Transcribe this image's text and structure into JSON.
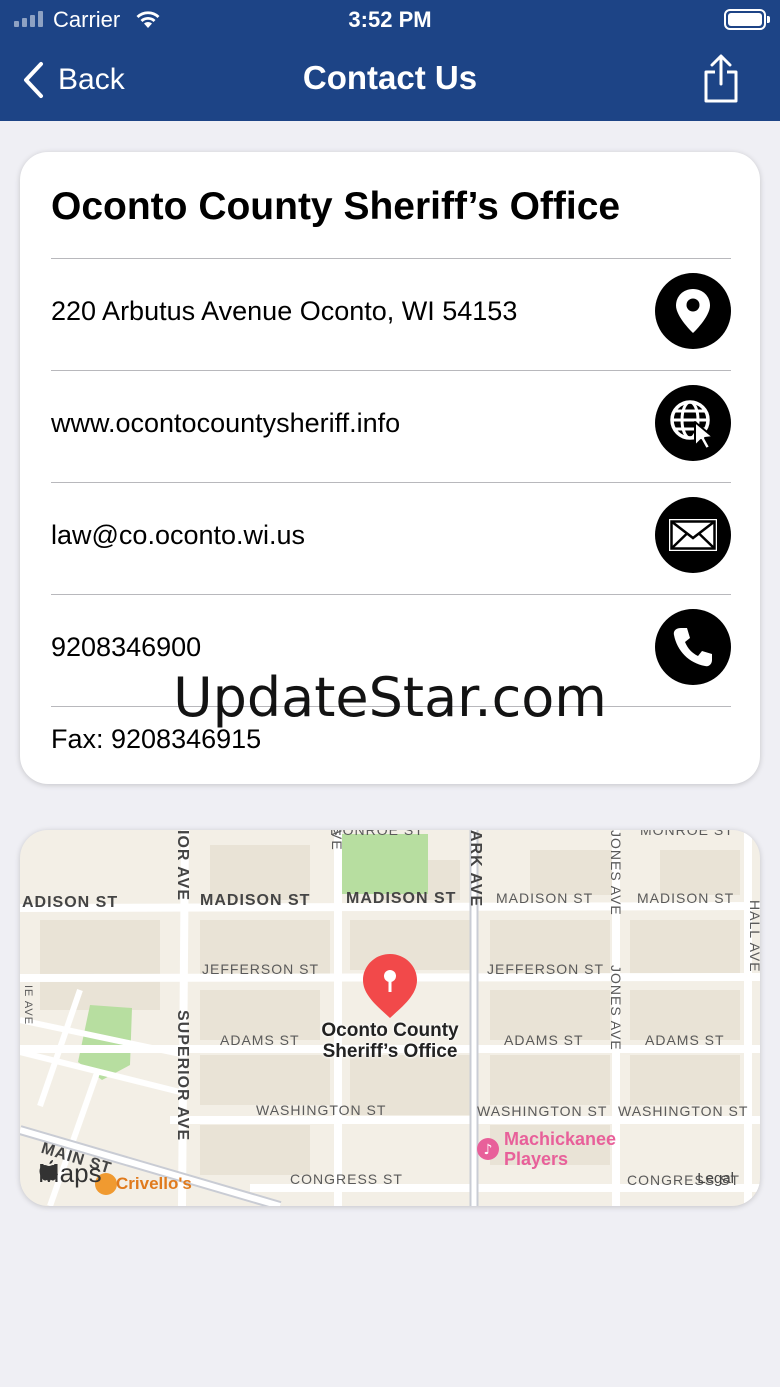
{
  "status_bar": {
    "carrier": "Carrier",
    "time": "3:52 PM",
    "battery_level": 1.0
  },
  "nav": {
    "back_label": "Back",
    "title": "Contact Us",
    "share_icon": "share-icon"
  },
  "contact": {
    "office_name": "Oconto County Sheriff’s Office",
    "rows": [
      {
        "text": "220 Arbutus Avenue  Oconto, WI 54153",
        "icon": "map-pin-icon"
      },
      {
        "text": "www.ocontocountysheriff.info",
        "icon": "web-icon"
      },
      {
        "text": "law@co.oconto.wi.us",
        "icon": "mail-icon"
      },
      {
        "text": "9208346900",
        "icon": "phone-icon"
      }
    ],
    "fax": "Fax: 9208346915"
  },
  "watermark": "UpdateStar.com",
  "map": {
    "streets": {
      "madison_st": "MADISON ST",
      "adison_st": "ADISON ST",
      "jefferson_st": "JEFFERSON ST",
      "adams_st": "ADAMS ST",
      "washington_st": "WASHINGTON ST",
      "congress_st": "CONGRESS ST",
      "main_st": "MAIN ST",
      "monroe_st": "MONROE ST",
      "superior_ave": "SUPERIOR AVE",
      "park_ave": "ARK AVE",
      "jones_ave": "JONES AVE",
      "hall_ave": "HALL AVE",
      "ior_ave": "IOR AVE",
      "ie_ave": "IE AVE",
      "ve": "VE"
    },
    "pin_label_line1": "Oconto County",
    "pin_label_line2": "Sheriff’s Office",
    "poi_line1": "Machickanee",
    "poi_line2": "Players",
    "business": "Crivello's",
    "maps_brand": "Maps",
    "legal": "Legal"
  }
}
